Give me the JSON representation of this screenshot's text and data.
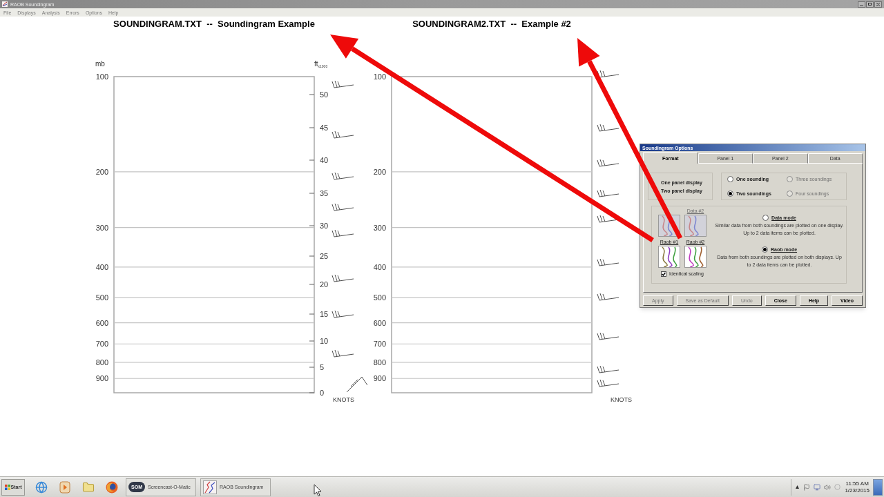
{
  "window": {
    "title": "RAOB Soundingram"
  },
  "menu": [
    {
      "label": "File"
    },
    {
      "label": "Displays"
    },
    {
      "label": "Analysis"
    },
    {
      "label": "Errors"
    },
    {
      "label": "Options"
    },
    {
      "label": "Help"
    }
  ],
  "panels": [
    {
      "title": "SOUNDINGRAM.TXT  --  Soundingram Example",
      "pressure_unit": "mb",
      "pressure_labels": [
        "100",
        "200",
        "300",
        "400",
        "500",
        "600",
        "700",
        "800",
        "900"
      ],
      "height_unit": "ft",
      "height_scale": "x1000",
      "height_labels": [
        "50",
        "45",
        "40",
        "35",
        "30",
        "25",
        "20",
        "15",
        "10",
        "5",
        "0"
      ],
      "wind_unit": "KNOTS"
    },
    {
      "title": "SOUNDINGRAM2.TXT  --  Example #2",
      "pressure_labels": [
        "100",
        "200",
        "300",
        "400",
        "500",
        "600",
        "700",
        "800",
        "900"
      ],
      "wind_unit": "KNOTS"
    }
  ],
  "dialog": {
    "title": "Soundingram Options",
    "tabs": [
      {
        "label": "Format",
        "selected": true
      },
      {
        "label": "Panel 1",
        "selected": false
      },
      {
        "label": "Panel 2",
        "selected": false
      },
      {
        "label": "Data",
        "selected": false
      }
    ],
    "panel_display": [
      {
        "label": "One panel display"
      },
      {
        "label": "Two panel display"
      }
    ],
    "soundings": [
      {
        "label": "One sounding",
        "selected": false,
        "disabled": false
      },
      {
        "label": "Two soundings",
        "selected": true,
        "disabled": false
      },
      {
        "label": "Three soundings",
        "selected": false,
        "disabled": true
      },
      {
        "label": "Four soundings",
        "selected": false,
        "disabled": true
      }
    ],
    "thumbnails": [
      {
        "disabled": true
      },
      {
        "label": "Data #2",
        "disabled": true
      },
      {
        "label": "Raob #1",
        "disabled": false
      },
      {
        "label": "Raob #2",
        "disabled": false
      }
    ],
    "identical_scaling": {
      "label": "Identical scaling",
      "checked": true
    },
    "modes": [
      {
        "label": "Data mode",
        "selected": false,
        "description": "Similar data from both soundings are plotted on one display. Up to 2 data items can be plotted."
      },
      {
        "label": "Raob mode",
        "selected": true,
        "description": "Data from both soundings are plotted on both displays. Up to 2 data items can be plotted."
      }
    ],
    "buttons": [
      {
        "label": "Apply",
        "disabled": true
      },
      {
        "label": "Save as Default",
        "disabled": true
      },
      {
        "label": "Undo",
        "disabled": true
      },
      {
        "label": "Close",
        "disabled": false
      },
      {
        "label": "Help",
        "disabled": false
      },
      {
        "label": "Video",
        "disabled": false
      }
    ]
  },
  "taskbar": {
    "start": "Start",
    "tasks": [
      {
        "label": "Screencast-O-Matic",
        "badge": "SOM"
      },
      {
        "label": "RAOB Soundingram"
      }
    ],
    "clock": {
      "time": "11:55 AM",
      "date": "1/23/2015"
    }
  }
}
